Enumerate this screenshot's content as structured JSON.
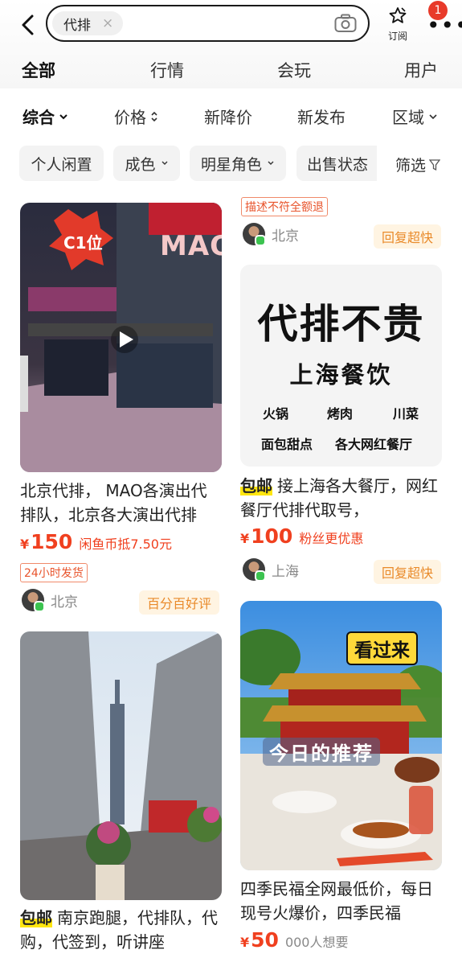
{
  "search": {
    "query": "代排",
    "clear": "×"
  },
  "header": {
    "subscribe_label": "订阅",
    "notification_count": "1"
  },
  "tabs": [
    {
      "label": "全部"
    },
    {
      "label": "行情"
    },
    {
      "label": "会玩"
    },
    {
      "label": "用户"
    }
  ],
  "sort": [
    {
      "label": "综合"
    },
    {
      "label": "价格"
    },
    {
      "label": "新降价"
    },
    {
      "label": "新发布"
    },
    {
      "label": "区域"
    }
  ],
  "filters": [
    {
      "label": "个人闲置"
    },
    {
      "label": "成色"
    },
    {
      "label": "明星角色"
    },
    {
      "label": "出售状态"
    }
  ],
  "filter_button": "筛选",
  "items": [
    {
      "image_badge": "C1位",
      "image_sign": "MAO",
      "title": "北京代排， MAO各演出代排队，北京各大演出代排",
      "price_symbol": "¥",
      "price": "150",
      "price_note": "闲鱼币抵7.50元",
      "tag": "24小时发货",
      "location": "北京",
      "seller_badge": "百分百好评"
    },
    {
      "tag": "描述不符全额退",
      "location": "北京",
      "seller_badge": "回复超快",
      "poster": {
        "headline": "代排不贵",
        "subhead": "上海餐饮",
        "row1": [
          "火锅",
          "烤肉",
          "川菜"
        ],
        "row2": [
          "面包甜点",
          "各大网红餐厅"
        ]
      },
      "free_shipping": "包邮",
      "title": "接上海各大餐厅，网红餐厅代排代取号，",
      "price_symbol": "¥",
      "price": "100",
      "price_note": "粉丝更优惠",
      "location2": "上海",
      "seller_badge2": "回复超快"
    },
    {
      "free_shipping": "包邮",
      "title": "南京跑腿，代排队，代购，代签到，听讲座"
    },
    {
      "image_text1": "看过来",
      "image_text2": "今日的推荐",
      "title": "四季民福全网最低价，每日现号火爆价，四季民福",
      "price_symbol": "¥",
      "price": "50",
      "price_note": "000人想要"
    }
  ],
  "colors": {
    "accent_yellow": "#ffe60f",
    "price_red": "#f0401f",
    "badge_orange": "#e98a2a"
  }
}
